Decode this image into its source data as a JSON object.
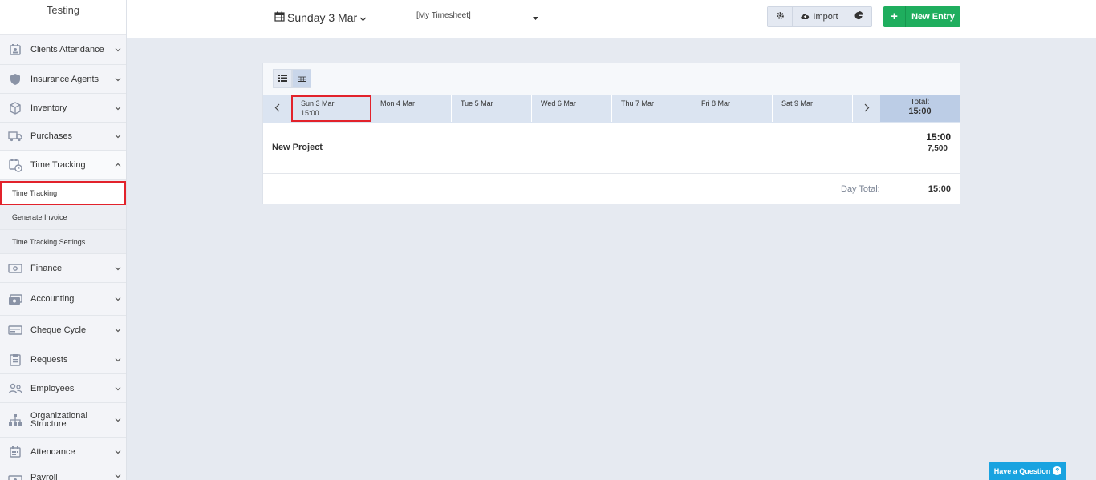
{
  "sidebar": {
    "brand": "Testing",
    "items": [
      {
        "label": "Clients Attendance",
        "icon": "calendar-user-icon"
      },
      {
        "label": "Insurance Agents",
        "icon": "shield-icon"
      },
      {
        "label": "Inventory",
        "icon": "box-icon"
      },
      {
        "label": "Purchases",
        "icon": "truck-icon"
      },
      {
        "label": "Time Tracking",
        "icon": "calendar-clock-icon"
      },
      {
        "label": "Finance",
        "icon": "money-icon"
      },
      {
        "label": "Accounting",
        "icon": "cash-register-icon"
      },
      {
        "label": "Cheque Cycle",
        "icon": "cheque-icon"
      },
      {
        "label": "Requests",
        "icon": "clipboard-icon"
      },
      {
        "label": "Employees",
        "icon": "users-icon"
      },
      {
        "label": "Organizational Structure",
        "icon": "sitemap-icon"
      },
      {
        "label": "Attendance",
        "icon": "calendar-icon"
      },
      {
        "label": "Payroll",
        "icon": "payroll-icon"
      }
    ],
    "sub_items": [
      {
        "label": "Time Tracking"
      },
      {
        "label": "Generate Invoice"
      },
      {
        "label": "Time Tracking Settings"
      }
    ]
  },
  "topbar": {
    "date": "Sunday 3 Mar",
    "timesheet": "[My Timesheet]",
    "import_label": "Import",
    "new_entry_label": "New Entry"
  },
  "week": {
    "days": [
      {
        "label": "Sun 3 Mar",
        "hours": "15:00"
      },
      {
        "label": "Mon 4 Mar",
        "hours": ""
      },
      {
        "label": "Tue 5 Mar",
        "hours": ""
      },
      {
        "label": "Wed 6 Mar",
        "hours": ""
      },
      {
        "label": "Thu 7 Mar",
        "hours": ""
      },
      {
        "label": "Fri 8 Mar",
        "hours": ""
      },
      {
        "label": "Sat 9 Mar",
        "hours": ""
      }
    ],
    "total_label": "Total:",
    "total_value": "15:00"
  },
  "project": {
    "name": "New Project",
    "hours": "15:00",
    "amount": "7,500"
  },
  "day_total": {
    "label": "Day Total:",
    "value": "15:00"
  },
  "help": {
    "label": "Have a Question"
  },
  "colors": {
    "accent_green": "#1fae5e",
    "highlight_red": "#e2222b",
    "help_blue": "#19a3e0"
  }
}
